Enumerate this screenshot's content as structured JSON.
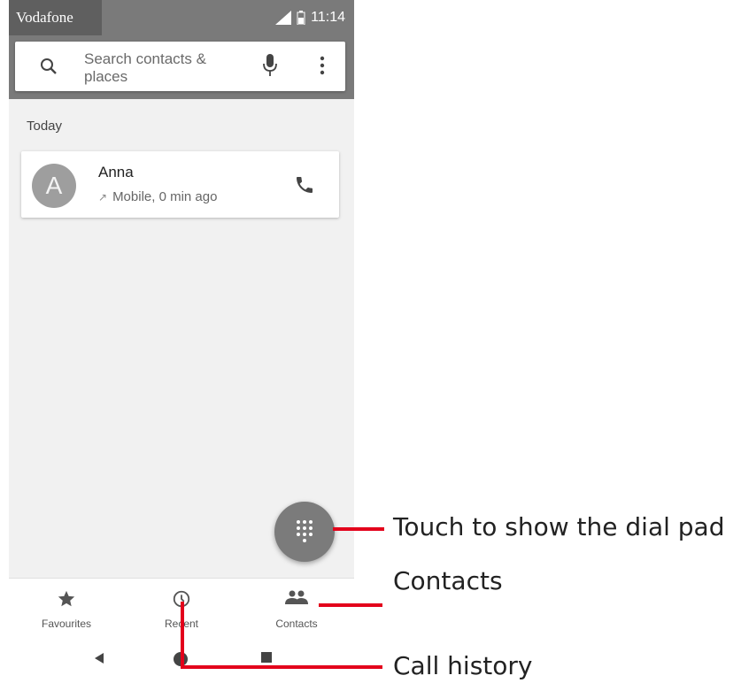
{
  "status_bar": {
    "carrier": "Vodafone",
    "time": "11:14"
  },
  "search": {
    "placeholder": "Search contacts & places"
  },
  "call_log": {
    "section": "Today",
    "entries": [
      {
        "initial": "A",
        "name": "Anna",
        "detail": "Mobile, 0 min ago"
      }
    ]
  },
  "bottom_nav": {
    "tabs": [
      {
        "label": "Favourites",
        "icon": "star-icon"
      },
      {
        "label": "Recent",
        "icon": "clock-icon"
      },
      {
        "label": "Contacts",
        "icon": "people-icon"
      }
    ]
  },
  "annotations": {
    "dialpad": "Touch to show the dial pad",
    "contacts": "Contacts",
    "history": "Call history"
  },
  "colors": {
    "accent_red": "#e3001b",
    "toolbar_gray": "#7a7a7a",
    "fab_gray": "#7b7b7b"
  }
}
